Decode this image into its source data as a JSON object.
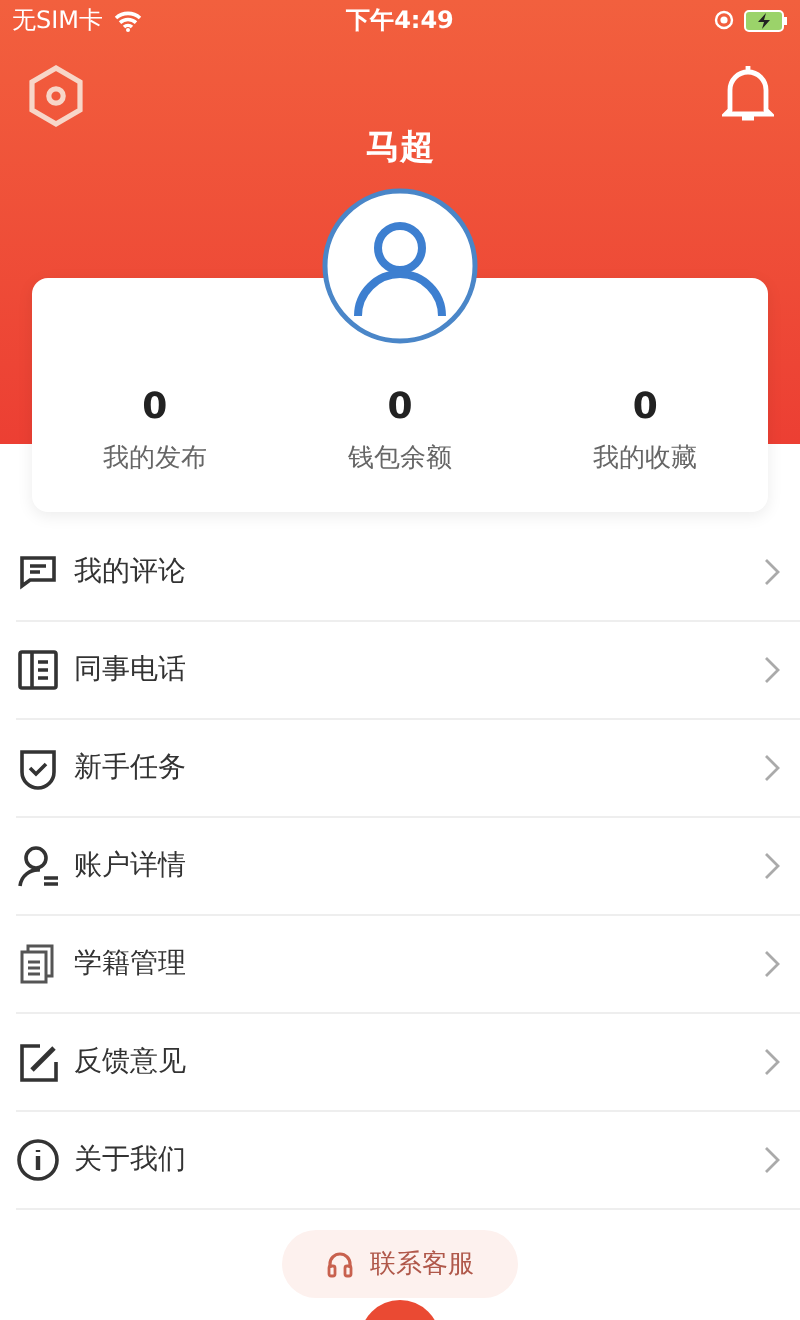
{
  "status_bar": {
    "carrier": "无SIM卡",
    "time": "下午4:49"
  },
  "profile": {
    "name": "马超"
  },
  "stats": [
    {
      "value": "0",
      "label": "我的发布"
    },
    {
      "value": "0",
      "label": "钱包余额"
    },
    {
      "value": "0",
      "label": "我的收藏"
    }
  ],
  "menu": [
    {
      "kind": "comment",
      "label": "我的评论"
    },
    {
      "kind": "contacts",
      "label": "同事电话"
    },
    {
      "kind": "task",
      "label": "新手任务"
    },
    {
      "kind": "account",
      "label": "账户详情"
    },
    {
      "kind": "docs",
      "label": "学籍管理"
    },
    {
      "kind": "feedback",
      "label": "反馈意见"
    },
    {
      "kind": "info",
      "label": "关于我们"
    }
  ],
  "support_button": {
    "label": "联系客服"
  }
}
